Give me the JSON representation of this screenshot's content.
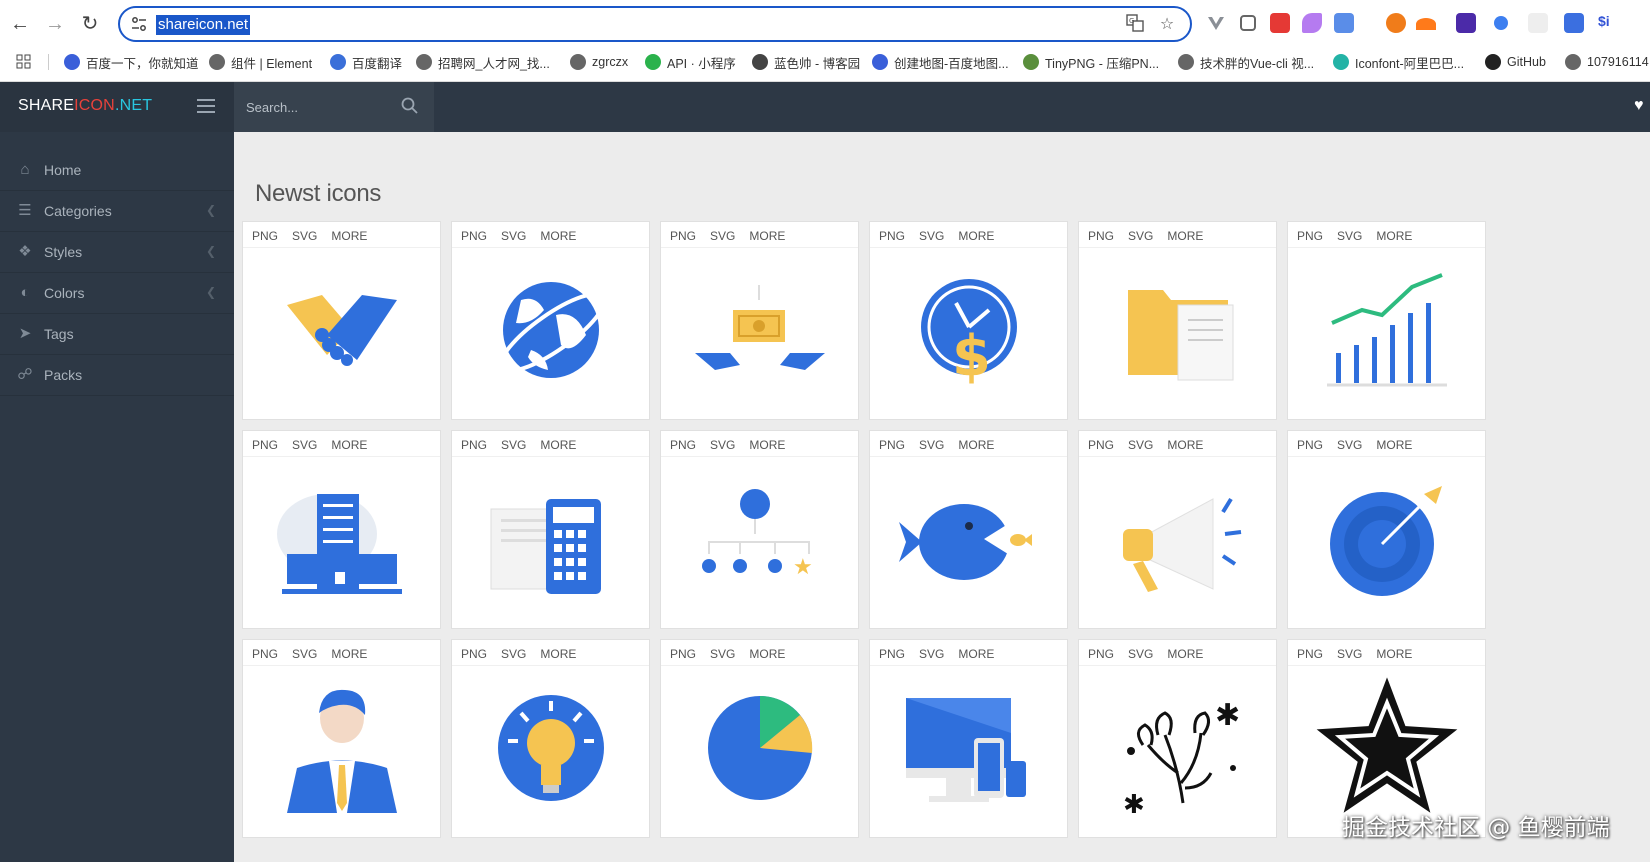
{
  "browser": {
    "url": "shareicon.net",
    "bookmarks": [
      {
        "label": "百度一下，你就知道",
        "color": "#3a5fd9"
      },
      {
        "label": "组件 | Element",
        "color": "#666"
      },
      {
        "label": "百度翻译",
        "color": "#3a6fd9"
      },
      {
        "label": "招聘网_人才网_找...",
        "color": "#666"
      },
      {
        "label": "zgrczx",
        "color": "#666"
      },
      {
        "label": "API · 小程序",
        "color": "#2bb24c"
      },
      {
        "label": "蓝色帅 - 博客园",
        "color": "#444"
      },
      {
        "label": "创建地图-百度地图...",
        "color": "#3a5fd9"
      },
      {
        "label": "TinyPNG - 压缩PN...",
        "color": "#5a8f3c"
      },
      {
        "label": "技术胖的Vue-cli 视...",
        "color": "#666"
      },
      {
        "label": "Iconfont-阿里巴巴...",
        "color": "#23b3a6"
      },
      {
        "label": "GitHub",
        "color": "#222"
      },
      {
        "label": "107916114",
        "color": "#666"
      }
    ]
  },
  "site": {
    "logo": {
      "part1": "SHARE",
      "part2": "ICON",
      "part3": ".NET"
    },
    "search_placeholder": "Search...",
    "menu": [
      {
        "label": "Home",
        "icon": "home-icon",
        "has_chevron": false
      },
      {
        "label": "Categories",
        "icon": "list-icon",
        "has_chevron": true
      },
      {
        "label": "Styles",
        "icon": "cubes-icon",
        "has_chevron": true
      },
      {
        "label": "Colors",
        "icon": "palette-icon",
        "has_chevron": true
      },
      {
        "label": "Tags",
        "icon": "tags-icon",
        "has_chevron": false
      },
      {
        "label": "Packs",
        "icon": "link-icon",
        "has_chevron": false
      }
    ],
    "section_title": "Newst icons",
    "card_links": {
      "png": "PNG",
      "svg": "SVG",
      "more": "MORE"
    },
    "icons": [
      "handshake-icon",
      "globe-icon",
      "money-hands-icon",
      "clock-dollar-icon",
      "folder-documents-icon",
      "growth-chart-icon",
      "office-building-icon",
      "calculator-papers-icon",
      "hierarchy-icon",
      "fish-icon",
      "megaphone-icon",
      "target-icon",
      "businessman-icon",
      "lightbulb-icon",
      "pie-chart-icon",
      "devices-icon",
      "flower-doodle-icon",
      "star-icon"
    ]
  },
  "watermark": "掘金技术社区 @ 鱼樱前端"
}
